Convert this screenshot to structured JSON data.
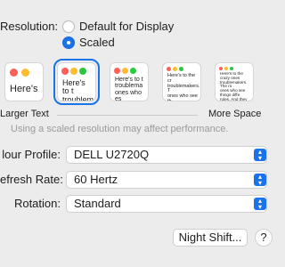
{
  "resolution": {
    "label": "Resolution:",
    "options": [
      "Default for Display",
      "Scaled"
    ],
    "selected_index": 1
  },
  "thumbnails": [
    {
      "text": "Here's"
    },
    {
      "text": "Here's to t\ntroublem"
    },
    {
      "text": "Here's to t\ntroublema\nones who\nes"
    },
    {
      "text": "Here's to the cr\ntroublemakers. T\nones who see th\nrules. And they\nnot respec"
    },
    {
      "text": "Here's to the crazy ones\ntroublemakers. The ro\nones who see things diffe\nrules. And they have no r\nnot respect the st"
    }
  ],
  "scale": {
    "left_label": "Larger Text",
    "right_label": "More Space"
  },
  "warning": "Using a scaled resolution may affect performance.",
  "colour_profile": {
    "label": "lour Profile:",
    "value": "DELL U2720Q"
  },
  "refresh_rate": {
    "label": "efresh Rate:",
    "value": "60 Hertz"
  },
  "rotation": {
    "label": "Rotation:",
    "value": "Standard"
  },
  "buttons": {
    "night_shift": "Night Shift...",
    "help": "?"
  },
  "colors": {
    "accent": "#1a73e8",
    "red": "#fe5f57",
    "yellow": "#febc2e",
    "green": "#28c840"
  }
}
